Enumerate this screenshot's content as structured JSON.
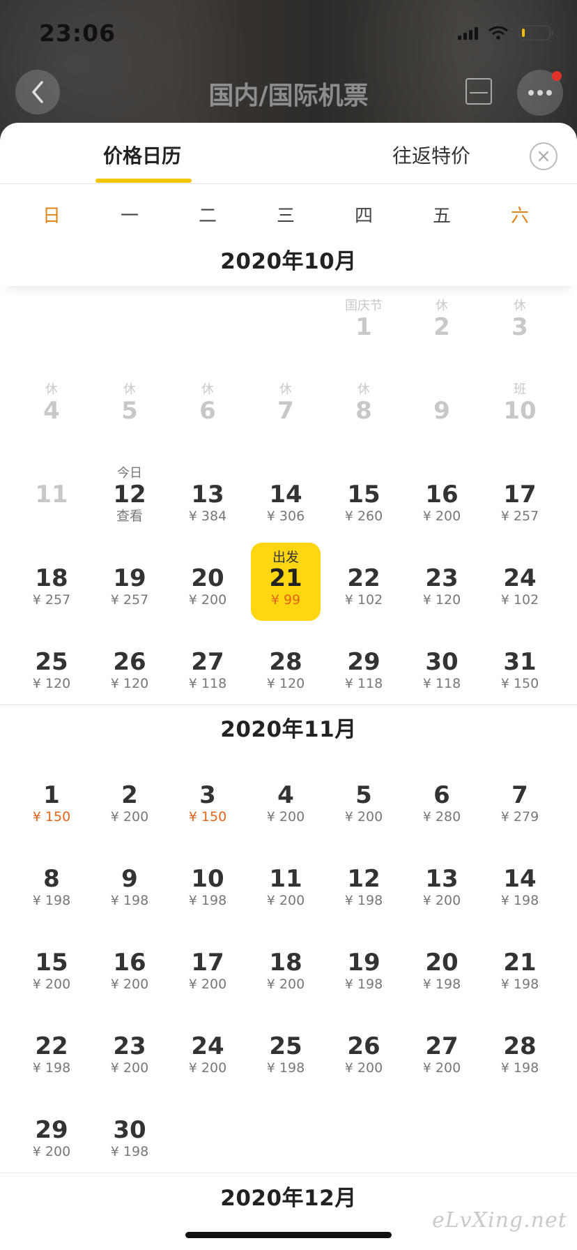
{
  "status_bar": {
    "time": "23:06"
  },
  "nav": {
    "title": "国内/国际机票"
  },
  "tabs": [
    {
      "label": "价格日历",
      "active": true
    },
    {
      "label": "往返特价",
      "active": false
    }
  ],
  "weekdays": [
    "日",
    "一",
    "二",
    "三",
    "四",
    "五",
    "六"
  ],
  "accent_color": "#ffd60f",
  "price_highlight_color": "#e0651a",
  "months": [
    {
      "title": "2020年10月",
      "lead_blank": 4,
      "days": [
        {
          "top": "国庆节",
          "num": "1",
          "sub": "",
          "state": "past"
        },
        {
          "top": "休",
          "num": "2",
          "sub": "",
          "state": "past"
        },
        {
          "top": "休",
          "num": "3",
          "sub": "",
          "state": "past"
        },
        {
          "top": "休",
          "num": "4",
          "sub": "",
          "state": "past"
        },
        {
          "top": "休",
          "num": "5",
          "sub": "",
          "state": "past"
        },
        {
          "top": "休",
          "num": "6",
          "sub": "",
          "state": "past"
        },
        {
          "top": "休",
          "num": "7",
          "sub": "",
          "state": "past"
        },
        {
          "top": "休",
          "num": "8",
          "sub": "",
          "state": "past"
        },
        {
          "top": "",
          "num": "9",
          "sub": "",
          "state": "past"
        },
        {
          "top": "班",
          "num": "10",
          "sub": "",
          "state": "past"
        },
        {
          "top": "",
          "num": "11",
          "sub": "",
          "state": "past"
        },
        {
          "top": "今日",
          "num": "12",
          "sub": "查看",
          "state": "today"
        },
        {
          "top": "",
          "num": "13",
          "sub": "¥ 384",
          "state": "normal"
        },
        {
          "top": "",
          "num": "14",
          "sub": "¥ 306",
          "state": "normal"
        },
        {
          "top": "",
          "num": "15",
          "sub": "¥ 260",
          "state": "normal"
        },
        {
          "top": "",
          "num": "16",
          "sub": "¥ 200",
          "state": "normal"
        },
        {
          "top": "",
          "num": "17",
          "sub": "¥ 257",
          "state": "normal"
        },
        {
          "top": "",
          "num": "18",
          "sub": "¥ 257",
          "state": "normal"
        },
        {
          "top": "",
          "num": "19",
          "sub": "¥ 257",
          "state": "normal"
        },
        {
          "top": "",
          "num": "20",
          "sub": "¥ 200",
          "state": "normal"
        },
        {
          "top": "出发",
          "num": "21",
          "sub": "¥ 99",
          "state": "selected"
        },
        {
          "top": "",
          "num": "22",
          "sub": "¥ 102",
          "state": "normal"
        },
        {
          "top": "",
          "num": "23",
          "sub": "¥ 120",
          "state": "normal"
        },
        {
          "top": "",
          "num": "24",
          "sub": "¥ 102",
          "state": "normal"
        },
        {
          "top": "",
          "num": "25",
          "sub": "¥ 120",
          "state": "normal"
        },
        {
          "top": "",
          "num": "26",
          "sub": "¥ 120",
          "state": "normal"
        },
        {
          "top": "",
          "num": "27",
          "sub": "¥ 118",
          "state": "normal"
        },
        {
          "top": "",
          "num": "28",
          "sub": "¥ 120",
          "state": "normal"
        },
        {
          "top": "",
          "num": "29",
          "sub": "¥ 118",
          "state": "normal"
        },
        {
          "top": "",
          "num": "30",
          "sub": "¥ 118",
          "state": "normal"
        },
        {
          "top": "",
          "num": "31",
          "sub": "¥ 150",
          "state": "normal"
        }
      ]
    },
    {
      "title": "2020年11月",
      "lead_blank": 0,
      "days": [
        {
          "top": "",
          "num": "1",
          "sub": "¥ 150",
          "state": "low"
        },
        {
          "top": "",
          "num": "2",
          "sub": "¥ 200",
          "state": "normal"
        },
        {
          "top": "",
          "num": "3",
          "sub": "¥ 150",
          "state": "low"
        },
        {
          "top": "",
          "num": "4",
          "sub": "¥ 200",
          "state": "normal"
        },
        {
          "top": "",
          "num": "5",
          "sub": "¥ 200",
          "state": "normal"
        },
        {
          "top": "",
          "num": "6",
          "sub": "¥ 280",
          "state": "normal"
        },
        {
          "top": "",
          "num": "7",
          "sub": "¥ 279",
          "state": "normal"
        },
        {
          "top": "",
          "num": "8",
          "sub": "¥ 198",
          "state": "normal"
        },
        {
          "top": "",
          "num": "9",
          "sub": "¥ 198",
          "state": "normal"
        },
        {
          "top": "",
          "num": "10",
          "sub": "¥ 198",
          "state": "normal"
        },
        {
          "top": "",
          "num": "11",
          "sub": "¥ 200",
          "state": "normal"
        },
        {
          "top": "",
          "num": "12",
          "sub": "¥ 198",
          "state": "normal"
        },
        {
          "top": "",
          "num": "13",
          "sub": "¥ 200",
          "state": "normal"
        },
        {
          "top": "",
          "num": "14",
          "sub": "¥ 198",
          "state": "normal"
        },
        {
          "top": "",
          "num": "15",
          "sub": "¥ 200",
          "state": "normal"
        },
        {
          "top": "",
          "num": "16",
          "sub": "¥ 200",
          "state": "normal"
        },
        {
          "top": "",
          "num": "17",
          "sub": "¥ 200",
          "state": "normal"
        },
        {
          "top": "",
          "num": "18",
          "sub": "¥ 200",
          "state": "normal"
        },
        {
          "top": "",
          "num": "19",
          "sub": "¥ 198",
          "state": "normal"
        },
        {
          "top": "",
          "num": "20",
          "sub": "¥ 198",
          "state": "normal"
        },
        {
          "top": "",
          "num": "21",
          "sub": "¥ 198",
          "state": "normal"
        },
        {
          "top": "",
          "num": "22",
          "sub": "¥ 198",
          "state": "normal"
        },
        {
          "top": "",
          "num": "23",
          "sub": "¥ 200",
          "state": "normal"
        },
        {
          "top": "",
          "num": "24",
          "sub": "¥ 200",
          "state": "normal"
        },
        {
          "top": "",
          "num": "25",
          "sub": "¥ 198",
          "state": "normal"
        },
        {
          "top": "",
          "num": "26",
          "sub": "¥ 200",
          "state": "normal"
        },
        {
          "top": "",
          "num": "27",
          "sub": "¥ 200",
          "state": "normal"
        },
        {
          "top": "",
          "num": "28",
          "sub": "¥ 198",
          "state": "normal"
        },
        {
          "top": "",
          "num": "29",
          "sub": "¥ 200",
          "state": "normal"
        },
        {
          "top": "",
          "num": "30",
          "sub": "¥ 198",
          "state": "normal"
        }
      ]
    },
    {
      "title": "2020年12月",
      "lead_blank": 0,
      "days": []
    }
  ],
  "watermark": "eLvXing.net"
}
